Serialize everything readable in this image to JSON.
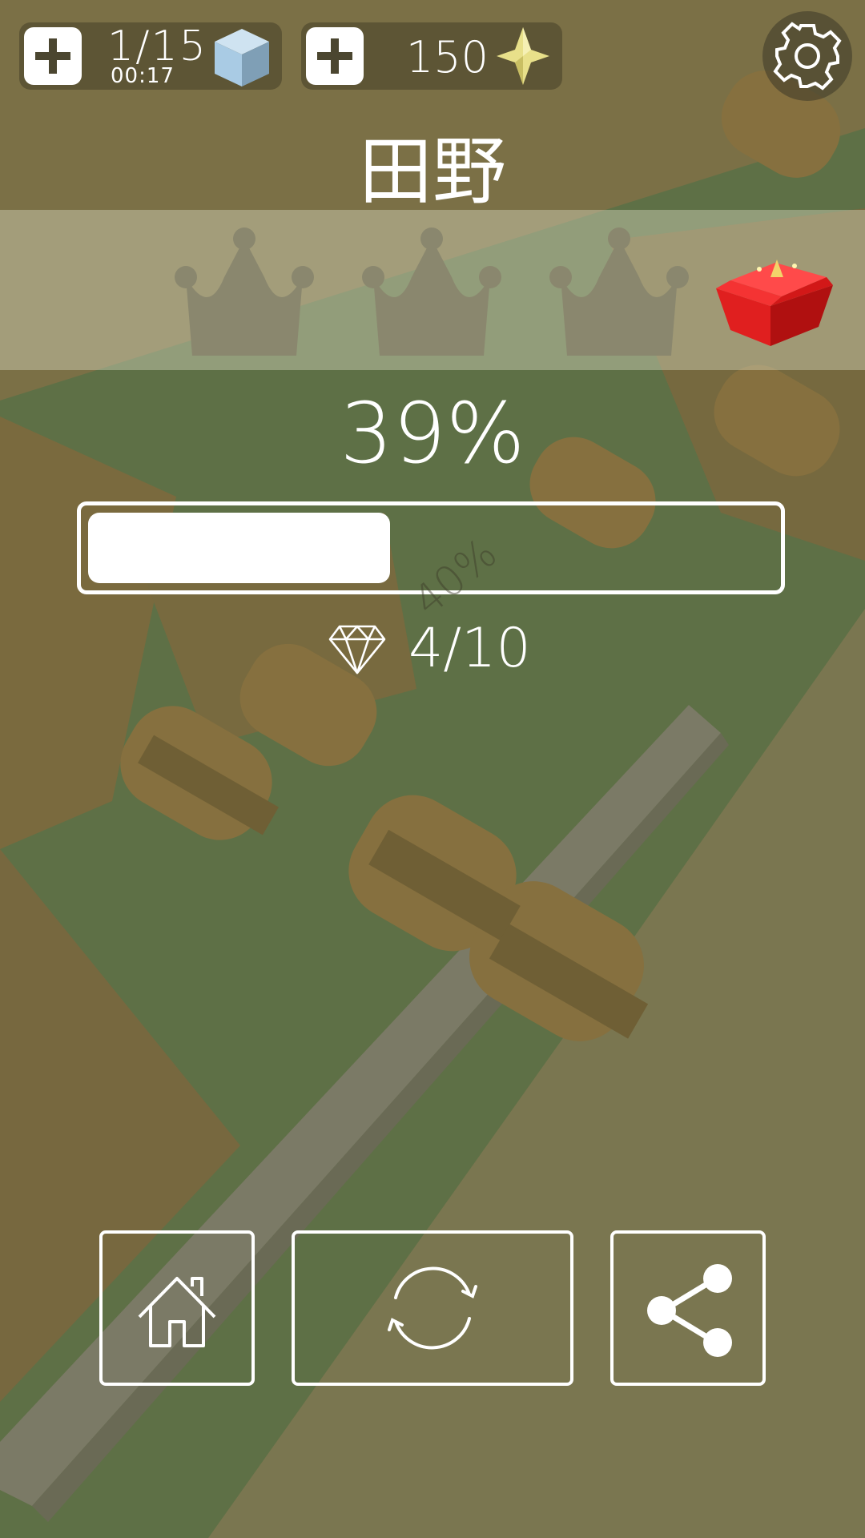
{
  "hud": {
    "level_progress": "1/15",
    "timer": "00:17",
    "coins": "150"
  },
  "title": "田野",
  "crowns_earned": 0,
  "crowns_total": 3,
  "progress": {
    "percent_label": "39%",
    "fill_fraction": 0.44,
    "marker_label": "40%"
  },
  "gems": {
    "count_label": "4/10"
  },
  "icons": {
    "level_add": "plus-icon",
    "cube": "cube-icon",
    "coins_add": "plus-icon",
    "star": "star-icon",
    "settings": "gear-icon",
    "crown": "crown-icon",
    "gift": "gift-box-icon",
    "gem": "diamond-icon",
    "home": "home-icon",
    "restart": "restart-icon",
    "share": "share-icon"
  },
  "colors": {
    "ground_green": "#5e7046",
    "block_brown": "#7a6a3e",
    "crown_gray": "#8a876e",
    "gift_red": "#e01f1f",
    "star_gold": "#e8e08a",
    "cube_blue": "#a9cbe4"
  }
}
